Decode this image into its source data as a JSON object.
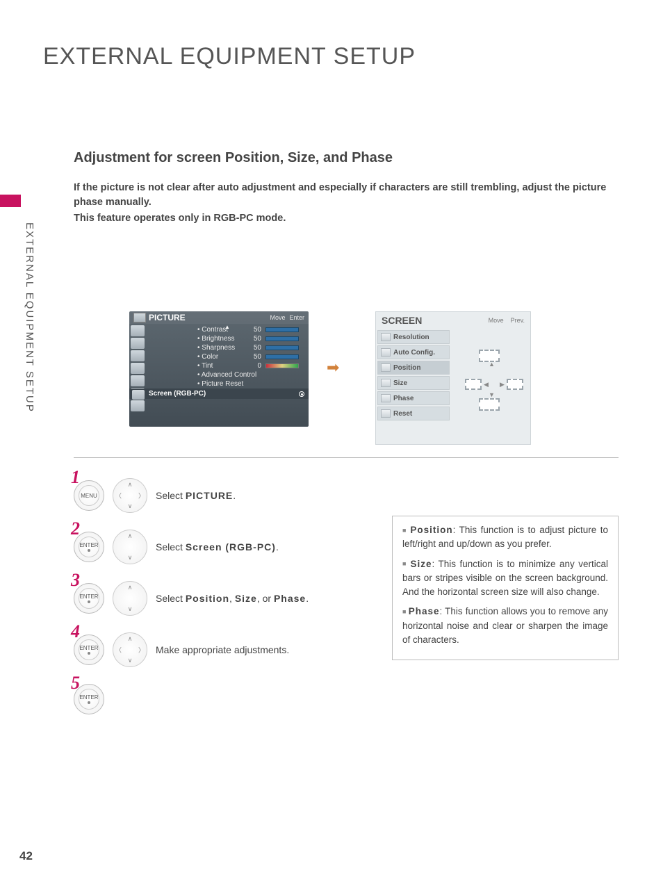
{
  "page_title": "EXTERNAL EQUIPMENT SETUP",
  "side_text": "EXTERNAL EQUIPMENT SETUP",
  "section_heading": "Adjustment for screen Position, Size, and Phase",
  "intro": {
    "p1": "If the picture is not clear after auto adjustment and especially if characters are still trembling, adjust the picture phase manually.",
    "p2": "This feature operates only in RGB-PC mode."
  },
  "picture_panel": {
    "title": "PICTURE",
    "move": "Move",
    "enter": "Enter",
    "rows": [
      {
        "label": "• Contrast",
        "val": "50"
      },
      {
        "label": "• Brightness",
        "val": "50"
      },
      {
        "label": "• Sharpness",
        "val": "50"
      },
      {
        "label": "• Color",
        "val": "50"
      },
      {
        "label": "• Tint",
        "val": "0"
      },
      {
        "label": "• Advanced Control",
        "val": ""
      },
      {
        "label": "• Picture Reset",
        "val": ""
      }
    ],
    "selected": "Screen (RGB-PC)"
  },
  "screen_panel": {
    "title": "SCREEN",
    "move": "Move",
    "prev": "Prev.",
    "items": [
      "Resolution",
      "Auto Config.",
      "Position",
      "Size",
      "Phase",
      "Reset"
    ]
  },
  "steps": [
    {
      "num": "1",
      "btn": "MENU",
      "dpad": "full",
      "text_pre": "Select ",
      "text_bold": "PICTURE",
      "text_post": "."
    },
    {
      "num": "2",
      "btn": "ENTER",
      "dpad": "vert",
      "text_pre": "Select ",
      "text_bold": "Screen (RGB-PC)",
      "text_post": "."
    },
    {
      "num": "3",
      "btn": "ENTER",
      "dpad": "vert",
      "text_pre": "Select ",
      "text_bold": "Position",
      "text_mid": ", ",
      "text_bold2": "Size",
      "text_mid2": ", or ",
      "text_bold3": "Phase",
      "text_post": "."
    },
    {
      "num": "4",
      "btn": "ENTER",
      "dpad": "full",
      "text_pre": "Make appropriate adjustments.",
      "text_bold": "",
      "text_post": ""
    },
    {
      "num": "5",
      "btn": "ENTER",
      "dpad": "",
      "text_pre": "",
      "text_bold": "",
      "text_post": ""
    }
  ],
  "info": {
    "position_label": "Position",
    "position_text": ": This function is to adjust picture to left/right and up/down as you prefer.",
    "size_label": "Size",
    "size_text": ": This function is to minimize any vertical bars or stripes visible on the screen background. And the horizontal screen size will also change.",
    "phase_label": "Phase",
    "phase_text": ": This function allows you to remove any horizontal noise and clear or sharpen the image of characters."
  },
  "page_number": "42"
}
